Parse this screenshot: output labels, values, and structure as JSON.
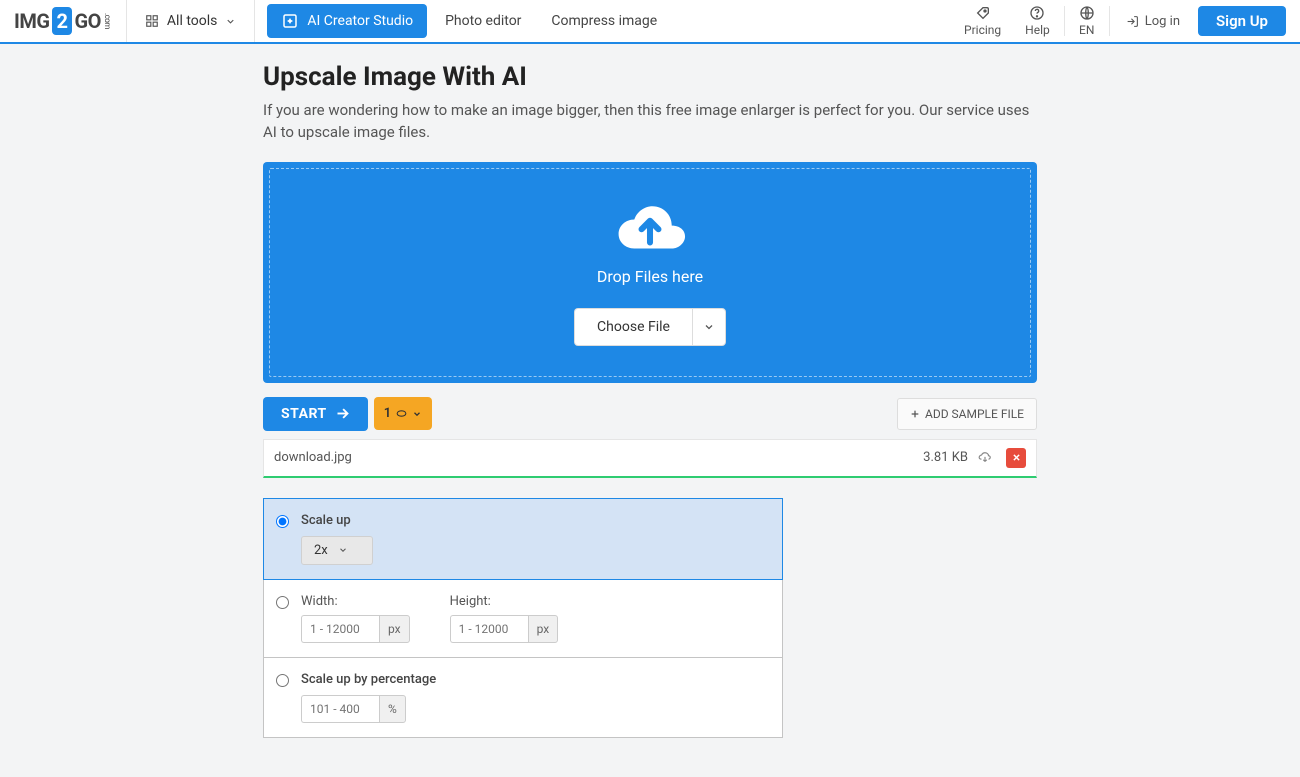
{
  "header": {
    "logo_pre": "IMG",
    "logo_box": "2",
    "logo_post": "GO",
    "logo_side": ".com",
    "all_tools": "All tools",
    "ai_creator": "AI Creator Studio",
    "photo_editor": "Photo editor",
    "compress": "Compress image",
    "pricing": "Pricing",
    "help": "Help",
    "lang": "EN",
    "login": "Log in",
    "signup": "Sign Up"
  },
  "page": {
    "title": "Upscale Image With AI",
    "subtitle": "If you are wondering how to make an image bigger, then this free image enlarger is perfect for you. Our service uses AI to upscale image files."
  },
  "drop": {
    "text": "Drop Files here",
    "choose": "Choose File"
  },
  "actions": {
    "start": "START",
    "credits": "1",
    "add_sample": "ADD SAMPLE FILE"
  },
  "file": {
    "name": "download.jpg",
    "size": "3.81 KB"
  },
  "options": {
    "scale_up_label": "Scale up",
    "scale_up_value": "2x",
    "width_label": "Width:",
    "height_label": "Height:",
    "dim_placeholder": "1 - 12000",
    "px": "px",
    "percent_label": "Scale up by percentage",
    "percent_placeholder": "101 - 400",
    "percent_unit": "%"
  }
}
